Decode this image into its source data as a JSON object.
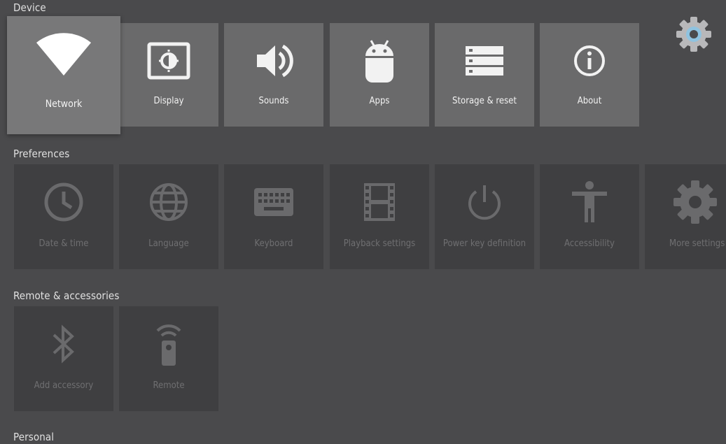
{
  "sections": {
    "device": "Device",
    "preferences": "Preferences",
    "remote": "Remote & accessories",
    "personal": "Personal"
  },
  "device": {
    "items": [
      {
        "label": "Network",
        "icon": "wifi-icon"
      },
      {
        "label": "Display",
        "icon": "display-icon"
      },
      {
        "label": "Sounds",
        "icon": "speaker-icon"
      },
      {
        "label": "Apps",
        "icon": "android-icon"
      },
      {
        "label": "Storage & reset",
        "icon": "storage-icon"
      },
      {
        "label": "About",
        "icon": "info-icon"
      }
    ]
  },
  "preferences": {
    "items": [
      {
        "label": "Date & time",
        "icon": "clock-icon"
      },
      {
        "label": "Language",
        "icon": "globe-icon"
      },
      {
        "label": "Keyboard",
        "icon": "keyboard-icon"
      },
      {
        "label": "Playback settings",
        "icon": "film-icon"
      },
      {
        "label": "Power key definition",
        "icon": "power-icon"
      },
      {
        "label": "Accessibility",
        "icon": "accessibility-icon"
      },
      {
        "label": "More settings",
        "icon": "gear-icon"
      }
    ]
  },
  "remote": {
    "items": [
      {
        "label": "Add accessory",
        "icon": "bluetooth-icon"
      },
      {
        "label": "Remote",
        "icon": "remote-icon"
      }
    ]
  },
  "colors": {
    "background": "#4a4a4c",
    "tile": "#6a6a6b",
    "tile_dim": "#3f3f41",
    "accent_gear": "#8fc3e0"
  }
}
